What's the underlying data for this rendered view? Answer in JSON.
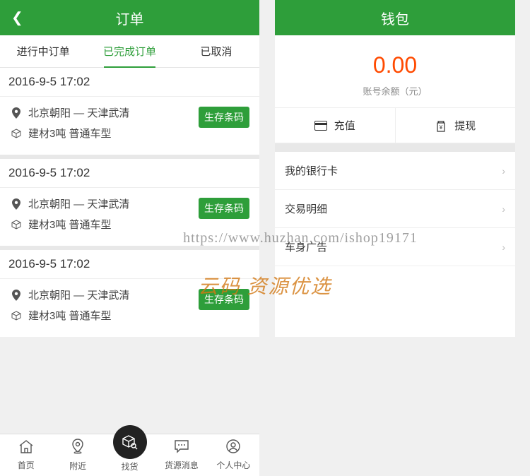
{
  "left": {
    "title": "订单",
    "tabs": [
      "进行中订单",
      "已完成订单",
      "已取消"
    ],
    "active_tab": 1,
    "orders": [
      {
        "time": "2016-9-5 17:02",
        "route": "北京朝阳 — 天津武清",
        "cargo": "建材3吨 普通车型",
        "btn": "生存条码"
      },
      {
        "time": "2016-9-5 17:02",
        "route": "北京朝阳 — 天津武清",
        "cargo": "建材3吨 普通车型",
        "btn": "生存条码"
      },
      {
        "time": "2016-9-5 17:02",
        "route": "北京朝阳 — 天津武清",
        "cargo": "建材3吨 普通车型",
        "btn": "生存条码"
      }
    ],
    "nav": [
      "首页",
      "附近",
      "找货",
      "货源消息",
      "个人中心"
    ]
  },
  "right": {
    "title": "钱包",
    "balance": "0.00",
    "balance_label": "账号余额（元）",
    "actions": {
      "recharge": "充值",
      "withdraw": "提现"
    },
    "menu": [
      "我的银行卡",
      "交易明细",
      "车身广告"
    ]
  },
  "watermarks": {
    "url": "https://www.huzhan.com/ishop19171",
    "text": "云码 资源优选"
  }
}
